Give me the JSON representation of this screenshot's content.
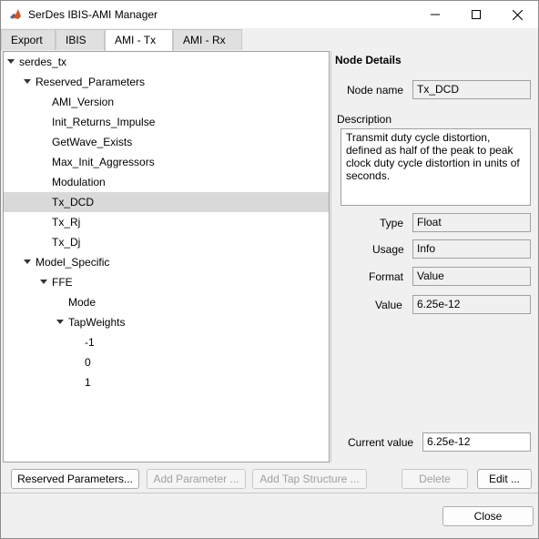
{
  "window": {
    "title": "SerDes IBIS-AMI Manager"
  },
  "tabs": [
    {
      "label": "Export"
    },
    {
      "label": "IBIS"
    },
    {
      "label": "AMI - Tx"
    },
    {
      "label": "AMI - Rx"
    }
  ],
  "active_tab": "AMI - Tx",
  "tree": {
    "root": "serdes_tx",
    "reserved_label": "Reserved_Parameters",
    "reserved_items": [
      "AMI_Version",
      "Init_Returns_Impulse",
      "GetWave_Exists",
      "Max_Init_Aggressors",
      "Modulation",
      "Tx_DCD",
      "Tx_Rj",
      "Tx_Dj"
    ],
    "model_specific_label": "Model_Specific",
    "ffe_label": "FFE",
    "mode_label": "Mode",
    "tapweights_label": "TapWeights",
    "taps": [
      "-1",
      "0",
      "1"
    ],
    "selected": "Tx_DCD"
  },
  "details": {
    "section_title": "Node Details",
    "node_name_label": "Node name",
    "node_name": "Tx_DCD",
    "description_label": "Description",
    "description": "Transmit duty cycle distortion, defined as half of the peak to peak clock duty cycle distortion in units of seconds.",
    "type_label": "Type",
    "type": "Float",
    "usage_label": "Usage",
    "usage": "Info",
    "format_label": "Format",
    "format": "Value",
    "value_label": "Value",
    "value": "6.25e-12",
    "current_value_label": "Current value",
    "current_value": "6.25e-12"
  },
  "buttons": {
    "reserved_parameters": "Reserved Parameters...",
    "add_parameter": "Add Parameter ...",
    "add_tap_structure": "Add Tap Structure ...",
    "delete": "Delete",
    "edit": "Edit ...",
    "close": "Close"
  }
}
